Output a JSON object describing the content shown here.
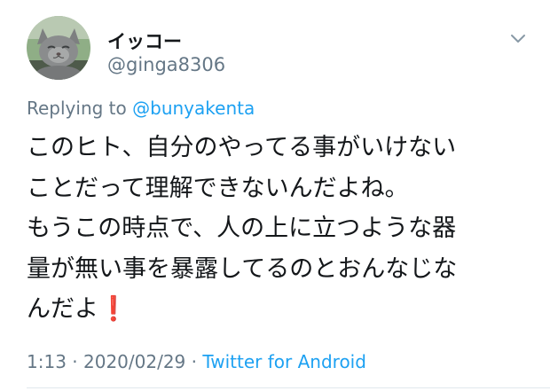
{
  "user": {
    "display_name": "イッコー",
    "handle": "@ginga8306"
  },
  "reply": {
    "prefix": "Replying to ",
    "mention": "@bunyakenta"
  },
  "tweet": {
    "lines": [
      "このヒト、自分のやってる事がいけない",
      "ことだって理解できないんだよね。",
      "もうこの時点で、人の上に立つような器",
      "量が無い事を暴露してるのとおんなじな",
      "んだよ❗"
    ]
  },
  "meta": {
    "time": "1:13",
    "separator1": " · ",
    "date": "2020/02/29",
    "separator2": " · ",
    "source": "Twitter for Android"
  },
  "colors": {
    "text": "#14171a",
    "secondary": "#657786",
    "link": "#1da1f2",
    "divider": "#e1e8ed"
  },
  "icons": {
    "avatar": "gray-cat-photo",
    "menu": "chevron-down-icon"
  }
}
